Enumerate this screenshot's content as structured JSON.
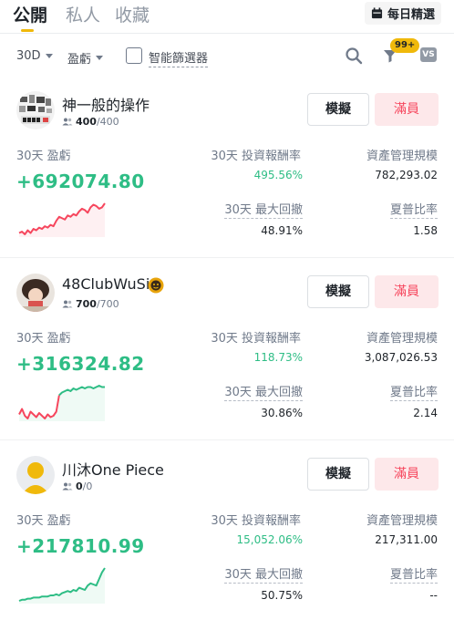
{
  "tabs": {
    "public": "公開",
    "private": "私人",
    "favorites": "收藏",
    "daily_picks": "每日精選"
  },
  "filters": {
    "period": "30D",
    "sort": "盈虧",
    "smart_filter": "智能篩選器",
    "notification_badge": "99+",
    "compare": "VS"
  },
  "labels": {
    "pnl": "30天 盈虧",
    "roi": "30天 投資報酬率",
    "aum": "資產管理規模",
    "mdd": "30天 最大回撤",
    "sharpe": "夏普比率",
    "copy": "模擬",
    "full": "滿員"
  },
  "traders": [
    {
      "name": "神一般的操作",
      "followers": "400",
      "max_followers": "/400",
      "pnl": "+692074.80",
      "roi": "495.56%",
      "aum": "782,293.02",
      "mdd": "48.91%",
      "sharpe": "1.58",
      "trend": "red",
      "spark": [
        12,
        13,
        11,
        14,
        12,
        15,
        14,
        16,
        15,
        17,
        16,
        18,
        17,
        21,
        24,
        23,
        22,
        25,
        24,
        26,
        25,
        28,
        30,
        29,
        27,
        31,
        33,
        32,
        30,
        31,
        34
      ]
    },
    {
      "name": "48ClubWuSi",
      "followers": "700",
      "max_followers": "/700",
      "pnl": "+316324.82",
      "roi": "118.73%",
      "aum": "3,087,026.53",
      "mdd": "30.86%",
      "sharpe": "2.14",
      "trend": "mixed",
      "spark": [
        16,
        20,
        15,
        13,
        18,
        16,
        14,
        17,
        15,
        13,
        16,
        14,
        15,
        18,
        30,
        32,
        33,
        34,
        33,
        35,
        34,
        35,
        36,
        35,
        36,
        36,
        35,
        36,
        37,
        36,
        36
      ]
    },
    {
      "name": "川沐One Piece",
      "followers": "0",
      "max_followers": "/0",
      "pnl": "+217810.99",
      "roi": "15,052.06%",
      "aum": "217,311.00",
      "mdd": "50.75%",
      "sharpe": "--",
      "trend": "green",
      "spark": [
        4,
        5,
        5,
        6,
        6,
        7,
        7,
        7,
        8,
        8,
        8,
        9,
        9,
        10,
        9,
        11,
        12,
        13,
        12,
        14,
        13,
        16,
        15,
        14,
        18,
        20,
        19,
        18,
        24,
        30,
        34
      ]
    }
  ],
  "colors": {
    "accent": "#f0b90b",
    "up": "#2ebd85",
    "down": "#f6465d"
  }
}
